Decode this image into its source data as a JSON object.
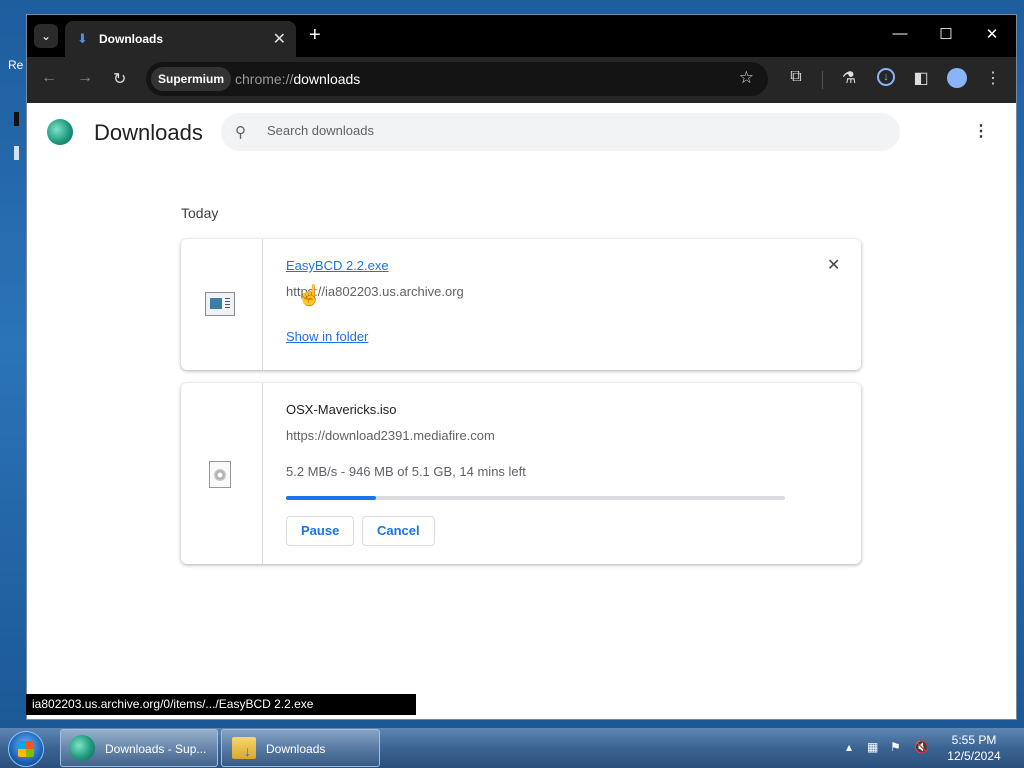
{
  "desktop": {
    "partial_label": "Re"
  },
  "browser": {
    "tab": {
      "title": "Downloads"
    },
    "window_controls": {
      "minimize": "—",
      "maximize": "☐",
      "close": "✕"
    },
    "profile_chip": "Supermium",
    "url_scheme": "chrome://",
    "url_host": "downloads"
  },
  "page": {
    "title": "Downloads",
    "search_placeholder": "Search downloads",
    "date_header": "Today",
    "downloads": [
      {
        "filename": "EasyBCD 2.2.exe",
        "source_url": "https://ia802203.us.archive.org",
        "action": "Show in folder",
        "state": "complete"
      },
      {
        "filename": "OSX-Mavericks.iso",
        "source_url": "https://download2391.mediafire.com",
        "status": "5.2 MB/s - 946 MB of 5.1 GB, 14 mins left",
        "progress_percent": 18,
        "buttons": [
          "Pause",
          "Cancel"
        ],
        "state": "in_progress"
      }
    ]
  },
  "statusbar": {
    "link": "ia802203.us.archive.org/0/items/.../EasyBCD 2.2.exe"
  },
  "taskbar": {
    "items": [
      {
        "label": "Downloads - Sup..."
      },
      {
        "label": "Downloads"
      }
    ],
    "clock_time": "5:55 PM",
    "clock_date": "12/5/2024"
  },
  "colors": {
    "accent": "#1a73e8",
    "chrome_dark": "#262626",
    "titlebar": "#000000"
  }
}
